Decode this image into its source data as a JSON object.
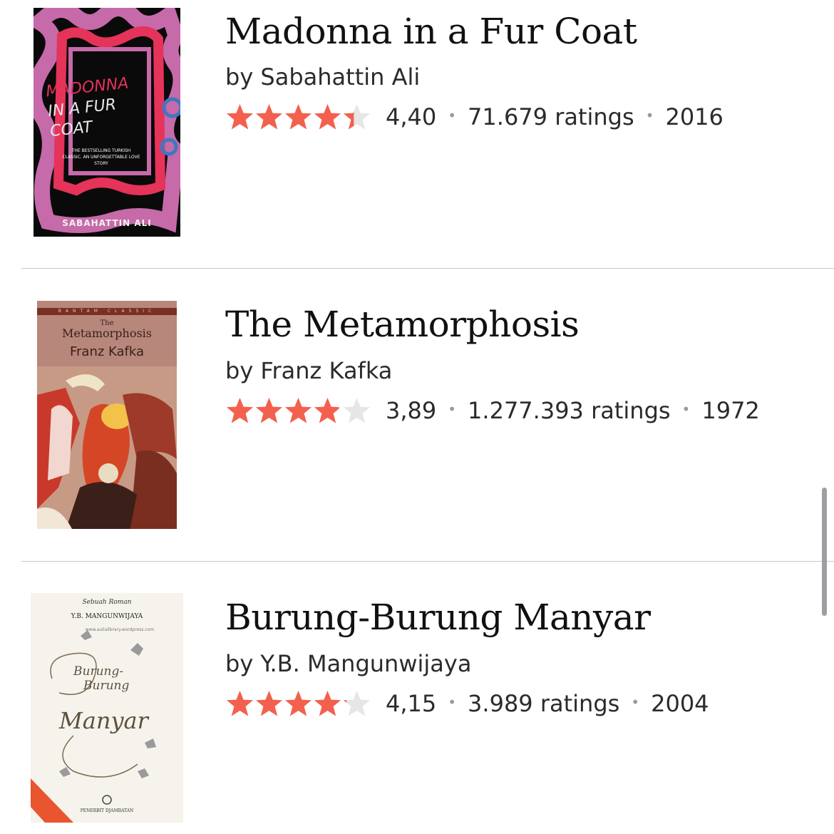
{
  "books": [
    {
      "title": "Madonna in a Fur Coat",
      "author": "by Sabahattin Ali",
      "rating": "4,40",
      "rating_value": 4.4,
      "ratings_count": "71.679 ratings",
      "year": "2016",
      "cover": {
        "title_line1": "MADONNA",
        "title_line2": "IN A FUR",
        "title_line3": "COAT",
        "tagline": "THE BESTSELLING TURKISH CLASSIC. AN UNFORGETTABLE LOVE STORY",
        "author": "SABAHATTIN ALI"
      }
    },
    {
      "title": "The Metamorphosis",
      "author": "by Franz Kafka",
      "rating": "3,89",
      "rating_value": 3.89,
      "ratings_count": "1.277.393 ratings",
      "year": "1972",
      "cover": {
        "series": "BANTAM CLASSIC",
        "the": "The",
        "title": "Metamorphosis",
        "author": "Franz Kafka"
      }
    },
    {
      "title": "Burung-Burung Manyar",
      "author": "by Y.B. Mangunwijaya",
      "rating": "4,15",
      "rating_value": 4.15,
      "ratings_count": "3.989 ratings",
      "year": "2004",
      "cover": {
        "kicker": "Sebuah Roman",
        "author": "Y.B. MANGUNWIJAYA",
        "url": "www.aulialibrary.wordpress.com",
        "title_line1": "Burung-",
        "title_line2": "Burung",
        "title_line3": "Manyar",
        "publisher": "PENERBIT DJAMBATAN"
      }
    }
  ],
  "colors": {
    "star_filled": "#f4604e",
    "star_empty": "#e6e6e6"
  }
}
